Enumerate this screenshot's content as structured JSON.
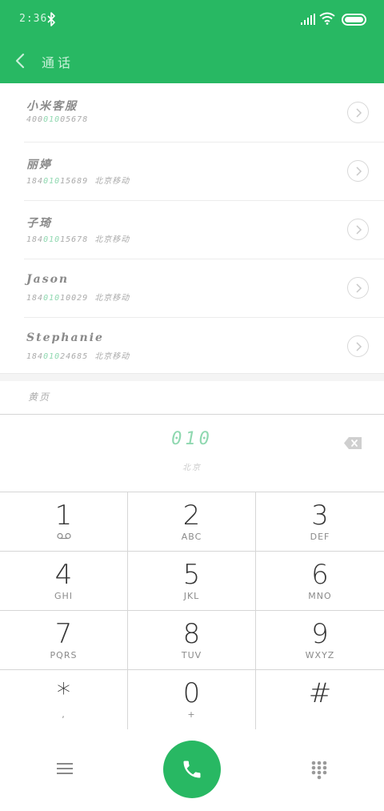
{
  "status_bar": {
    "time": "2:36"
  },
  "nav": {
    "title": "通话"
  },
  "contacts": [
    {
      "name": "小米客服",
      "number_prefix": "400",
      "number_match": "010",
      "number_suffix": "05678",
      "location": ""
    },
    {
      "name": "丽婷",
      "number_prefix": "184",
      "number_match": "010",
      "number_suffix": "15689",
      "location": "北京移动"
    },
    {
      "name": "子琦",
      "number_prefix": "184",
      "number_match": "010",
      "number_suffix": "15678",
      "location": "北京移动"
    },
    {
      "name": "Jason",
      "number_prefix": "184",
      "number_match": "010",
      "number_suffix": "10029",
      "location": "北京移动"
    },
    {
      "name": "Stephanie",
      "number_prefix": "184",
      "number_match": "010",
      "number_suffix": "24685",
      "location": "北京移动"
    }
  ],
  "yellow_pages": "黄页",
  "dialed": {
    "number": "010",
    "location": "北京"
  },
  "keypad": [
    {
      "digit": "1",
      "letters": ""
    },
    {
      "digit": "2",
      "letters": "ABC"
    },
    {
      "digit": "3",
      "letters": "DEF"
    },
    {
      "digit": "4",
      "letters": "GHI"
    },
    {
      "digit": "5",
      "letters": "JKL"
    },
    {
      "digit": "6",
      "letters": "MNO"
    },
    {
      "digit": "7",
      "letters": "PQRS"
    },
    {
      "digit": "8",
      "letters": "TUV"
    },
    {
      "digit": "9",
      "letters": "WXYZ"
    },
    {
      "digit": "*",
      "letters": ","
    },
    {
      "digit": "0",
      "letters": "+"
    },
    {
      "digit": "#",
      "letters": ""
    }
  ],
  "colors": {
    "accent": "#28b863",
    "match": "#8fd8b0"
  },
  "icons": [
    "bluetooth-icon",
    "signal-icon",
    "wifi-icon",
    "battery-icon",
    "back-icon",
    "chevron-right-icon",
    "backspace-icon",
    "voicemail-icon",
    "menu-icon",
    "phone-icon",
    "dialpad-icon"
  ]
}
